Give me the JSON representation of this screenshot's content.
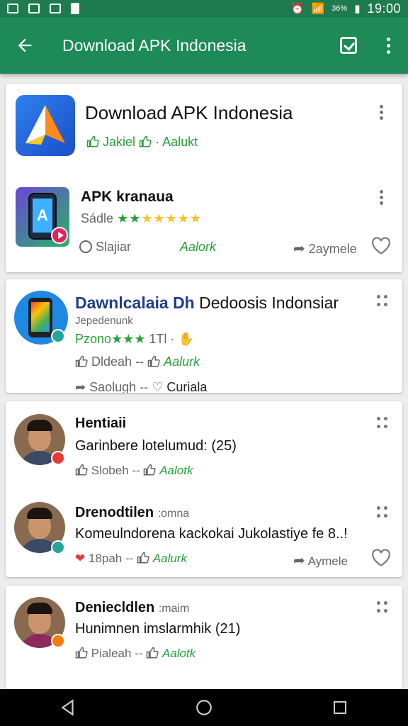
{
  "status_bar": {
    "battery_pct": "36%",
    "time": "19:00"
  },
  "app_bar": {
    "title": "Download APK Indonesia"
  },
  "card1": {
    "title": "Download APK Indonesia",
    "like_label": "Jakiel",
    "separator": "·",
    "action_label": "Aalukt",
    "sub_app": {
      "name": "APK kranaua",
      "rating_label": "Sádle",
      "stars": 5,
      "left_action": "Slajiar",
      "green_action": "Aalork",
      "share_label": "2aymele"
    }
  },
  "card2": {
    "title": "Dawnlcalaia Dh",
    "title_rest": "Dedoosis Indonsiar",
    "subtitle": "Jepedenunk",
    "rating_label": "Pzono",
    "rating_count": "1Tl",
    "row1_left": "Dldeah",
    "row1_sep": "--",
    "row1_right": "Aalurk",
    "row2_left": "Saolugh",
    "row2_sep": "--",
    "row2_right": "Curiala"
  },
  "comments": [
    {
      "name": "Hentiaii",
      "handle": "",
      "text": "Garinbere lotelumud: (25)",
      "left_action": "Slobeh",
      "sep": "--",
      "green_action": "Aalotk"
    },
    {
      "name": "Drenodtilen",
      "handle": ":omna",
      "text": "Komeulndorena kackokai Jukolastiye fe 8..!",
      "left_action": "18pah",
      "sep": "--",
      "green_action": "Aalurk",
      "share_label": "Aymele"
    },
    {
      "name": "Deniecldlen",
      "handle": ":maim",
      "text": "Hunimnen imslarmhik (21)",
      "left_action": "Pialeah",
      "sep": "--",
      "green_action": "Aalotk"
    }
  ],
  "colors": {
    "primary": "#1d8a57",
    "accent_green": "#27a03a",
    "star_yellow": "#f5c518"
  }
}
